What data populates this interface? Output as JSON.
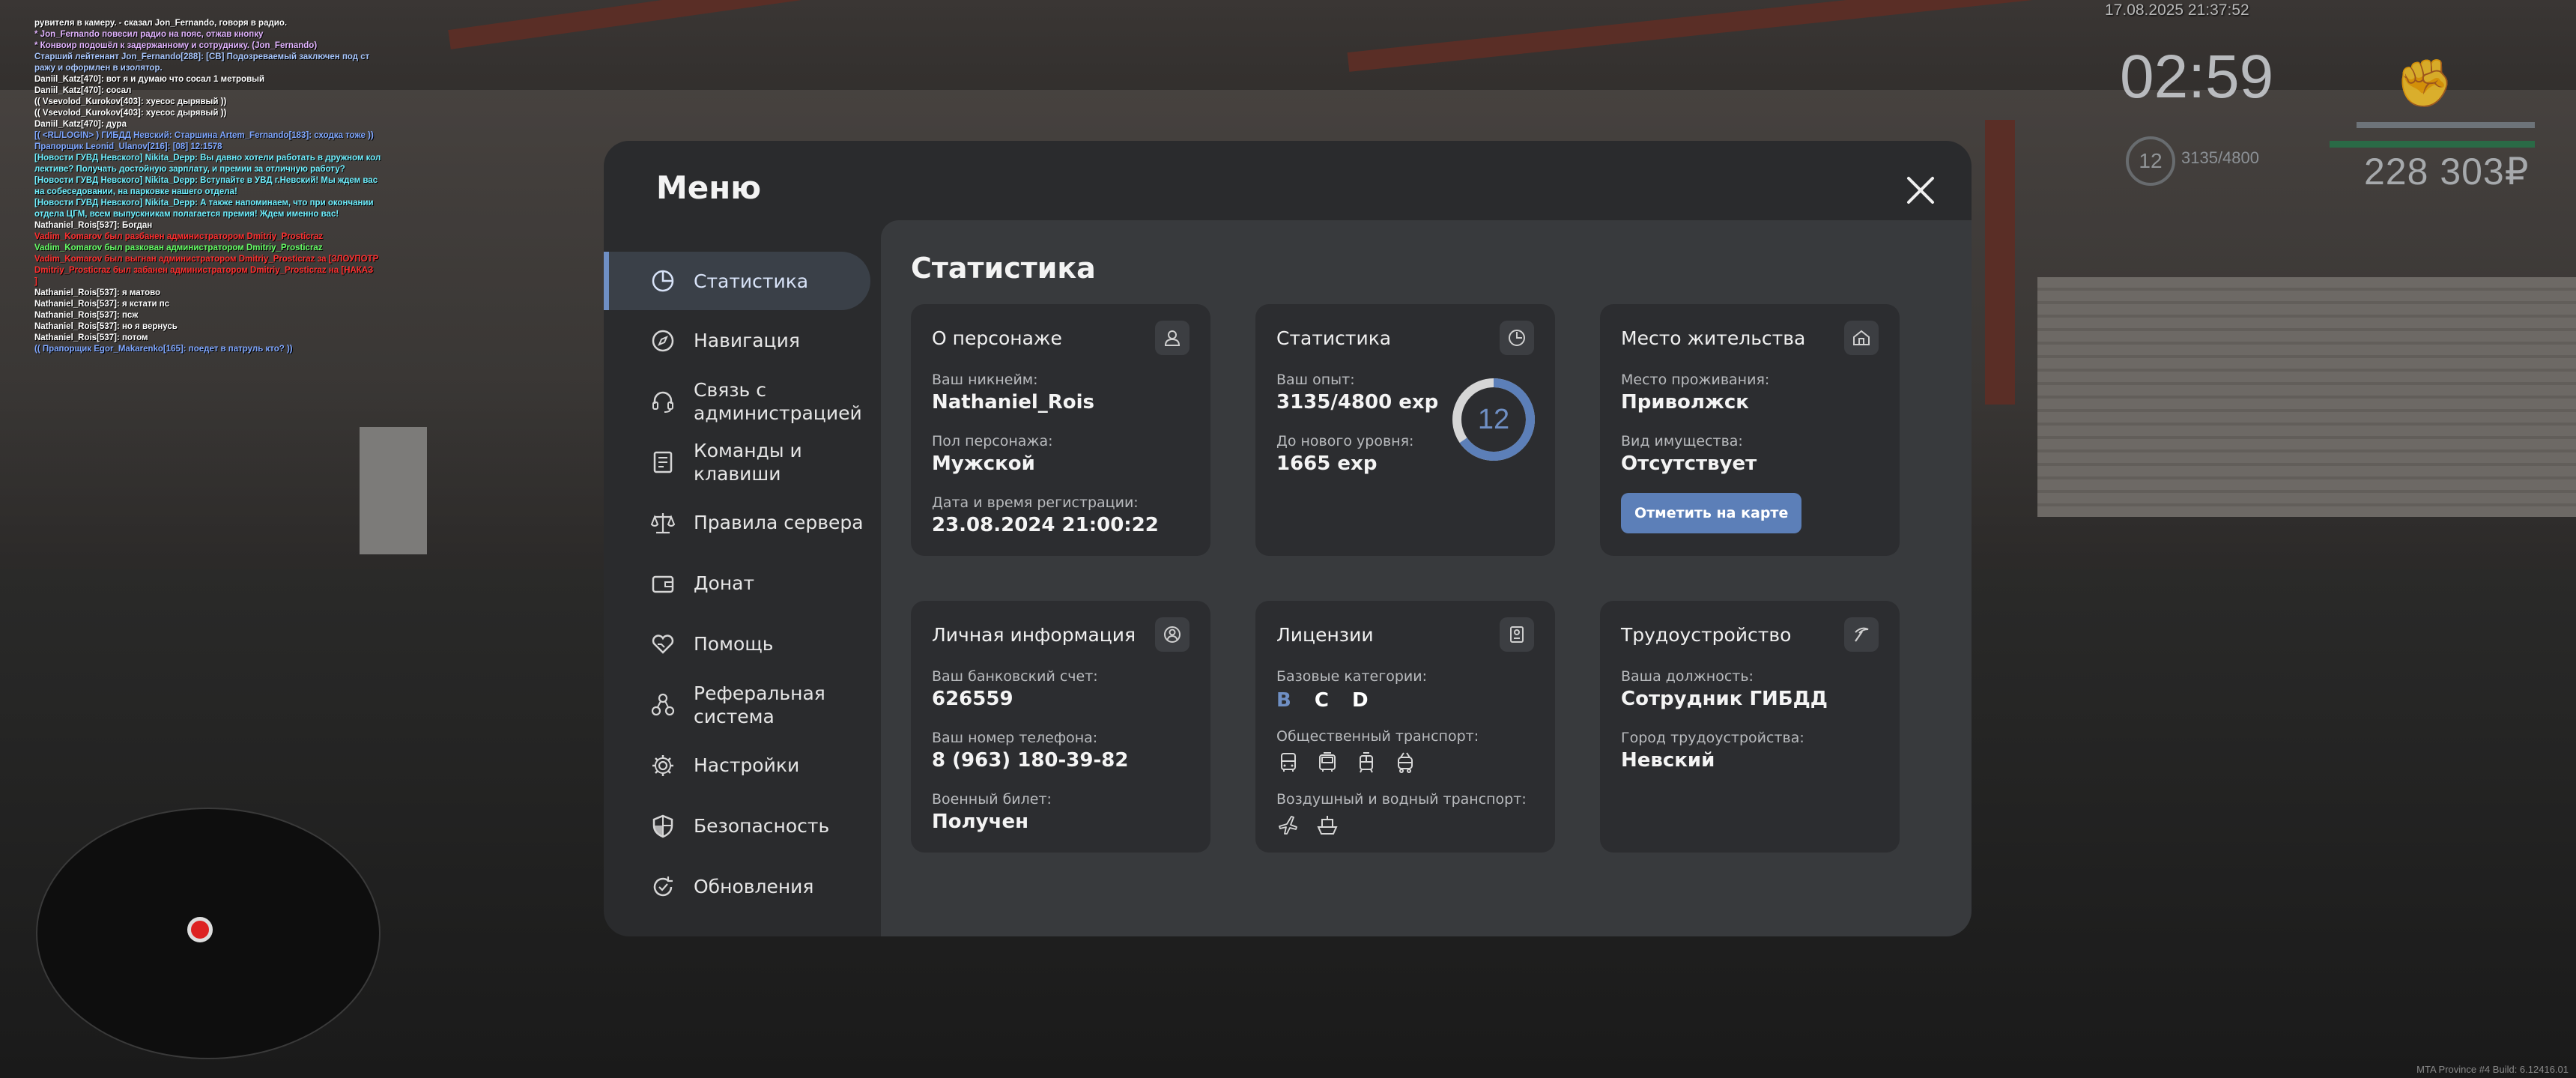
{
  "chat": [
    {
      "text": "рувителя в камеру. - сказал Jon_Fernando, говоря в радио.",
      "color": "#ffffff"
    },
    {
      "text": "* Jon_Fernando повесил радио на пояс, отжав кнопку",
      "color": "#e2b4ff"
    },
    {
      "text": "* Конвоир подошёл к задержанному и сотруднику. (Jon_Fernando)",
      "color": "#e2b4ff"
    },
    {
      "text": "Старший лейтенант Jon_Fernando[288]: [CB] Подозреваемый заключен под ст",
      "color": "#a9c8ff"
    },
    {
      "text": "ражу и оформлен в изолятор.",
      "color": "#a9c8ff"
    },
    {
      "text": "Daniil_Katz[470]: вот я и думаю что сосал 1 метровый",
      "color": "#ffffff"
    },
    {
      "text": "Daniil_Katz[470]: сосал",
      "color": "#ffffff"
    },
    {
      "text": "(( Vsevolod_Kurokov[403]: хуесос дырявый ))",
      "color": "#ffffff"
    },
    {
      "text": "(( Vsevolod_Kurokov[403]: хуесос дырявый ))",
      "color": "#ffffff"
    },
    {
      "text": "Daniil_Katz[470]: дура",
      "color": "#ffffff"
    },
    {
      "text": "[( <RL/LOGIN> ) ГИБДД Невский: Старшина Artem_Fernando[183]: сходка тоже ))",
      "color": "#7fa7ff"
    },
    {
      "text": "Прапорщик Leonid_Ulanov[216]: [08] 12:1578",
      "color": "#7fa7ff"
    },
    {
      "text": "[Новости ГУВД Невского] Nikita_Depp: Вы давно хотели работать в дружном кол",
      "color": "#6ff0ff"
    },
    {
      "text": "лективе? Получать достойную зарплату, и премии за отличную работу?",
      "color": "#6ff0ff"
    },
    {
      "text": "[Новости ГУВД Невского] Nikita_Depp: Вступайте в УВД г.Невский! Мы ждем вас",
      "color": "#6ff0ff"
    },
    {
      "text": "на собеседовании, на парковке нашего отдела!",
      "color": "#6ff0ff"
    },
    {
      "text": "[Новости ГУВД Невского] Nikita_Depp: А также напоминаем, что при окончании",
      "color": "#6ff0ff"
    },
    {
      "text": "отдела ЦГМ, всем выпускникам полагается премия! Ждем именно вас!",
      "color": "#6ff0ff"
    },
    {
      "text": "Nathaniel_Rois[537]: Богдан",
      "color": "#ffffff"
    },
    {
      "text": "Vadim_Komarov был разбанен администратором Dmitriy_Prosticraz",
      "color": "#ff3030"
    },
    {
      "text": "Vadim_Komarov был разкован администратором Dmitriy_Prosticraz",
      "color": "#66ff66"
    },
    {
      "text": "Vadim_Komarov был выгнан администратором Dmitriy_Prosticraz за [ЗЛОУПОТР",
      "color": "#ff3030"
    },
    {
      "text": "Dmitriy_Prosticraz был забанен администратором Dmitriy_Prosticraz на [НАКАЗ",
      "color": "#ff3030"
    },
    {
      "text": "]",
      "color": "#ff3030"
    },
    {
      "text": "Nathaniel_Rois[537]: я матово",
      "color": "#ffffff"
    },
    {
      "text": "Nathaniel_Rois[537]: я кстати пс",
      "color": "#ffffff"
    },
    {
      "text": "Nathaniel_Rois[537]: псж",
      "color": "#ffffff"
    },
    {
      "text": "Nathaniel_Rois[537]: но я вернусь",
      "color": "#ffffff"
    },
    {
      "text": "Nathaniel_Rois[537]: потом",
      "color": "#ffffff"
    },
    {
      "text": "(( Прапорщик Egor_Makarenko[165]: поедет в патруль кто? ))",
      "color": "#7fa7ff"
    }
  ],
  "hud": {
    "date": "17.08.2025 21:37:52",
    "time": "02:59",
    "level": "12",
    "exp": "3135/4800",
    "money": "228 303₽",
    "build": "MTA Province #4 Build: 6.12416.01"
  },
  "menu": {
    "title": "Меню",
    "nav": [
      {
        "label": "Статистика",
        "icon": "pie-chart-icon"
      },
      {
        "label": "Навигация",
        "icon": "compass-icon"
      },
      {
        "label": "Связь с администрацией",
        "icon": "headset-icon"
      },
      {
        "label": "Команды и клавиши",
        "icon": "keyboard-icon"
      },
      {
        "label": "Правила сервера",
        "icon": "scales-icon"
      },
      {
        "label": "Донат",
        "icon": "wallet-icon"
      },
      {
        "label": "Помощь",
        "icon": "heart-hand-icon"
      },
      {
        "label": "Реферальная система",
        "icon": "referral-icon"
      },
      {
        "label": "Настройки",
        "icon": "gear-icon"
      },
      {
        "label": "Безопасность",
        "icon": "shield-icon"
      },
      {
        "label": "Обновления",
        "icon": "update-icon"
      }
    ]
  },
  "content": {
    "title": "Статистика",
    "character": {
      "title": "О персонаже",
      "nickname_label": "Ваш никнейм:",
      "nickname": "Nathaniel_Rois",
      "gender_label": "Пол персонажа:",
      "gender": "Мужской",
      "reg_label": "Дата и время регистрации:",
      "reg": "23.08.2024 21:00:22"
    },
    "stats": {
      "title": "Статистика",
      "exp_label": "Ваш опыт:",
      "exp": "3135/4800 exp",
      "next_label": "До нового уровня:",
      "next": "1665 exp",
      "level": "12",
      "progress": 0.653
    },
    "residence": {
      "title": "Место жительства",
      "place_label": "Место проживания:",
      "place": "Приволжск",
      "property_label": "Вид имущества:",
      "property": "Отсутствует",
      "button": "Отметить на карте"
    },
    "personal": {
      "title": "Личная информация",
      "bank_label": "Ваш банковский счет:",
      "bank": "626559",
      "phone_label": "Ваш номер телефона:",
      "phone": "8 (963) 180-39-82",
      "military_label": "Военный билет:",
      "military": "Получен"
    },
    "licenses": {
      "title": "Лицензии",
      "base_label": "Базовые категории:",
      "categories": [
        "B",
        "C",
        "D"
      ],
      "public_label": "Общественный транспорт:",
      "air_label": "Воздушный и водный транспорт:"
    },
    "employment": {
      "title": "Трудоустройство",
      "position_label": "Ваша должность:",
      "position": "Сотрудник ГИБДД",
      "city_label": "Город трудоустройства:",
      "city": "Невский"
    }
  },
  "colors": {
    "accent": "#6f8fc4",
    "button": "#5c7fb8",
    "category_active": "#6f8fc4"
  }
}
